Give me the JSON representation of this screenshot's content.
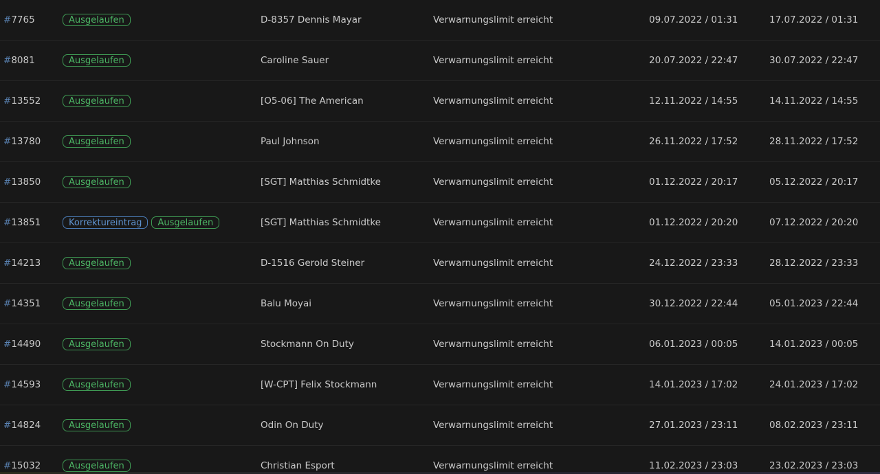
{
  "rows": [
    {
      "id": "7765",
      "badges": [
        {
          "label": "Ausgelaufen",
          "color": "green"
        }
      ],
      "name": "D-8357 Dennis Mayar",
      "reason": "Verwarnungslimit erreicht",
      "start": "09.07.2022 / 01:31",
      "end": "17.07.2022 / 01:31"
    },
    {
      "id": "8081",
      "badges": [
        {
          "label": "Ausgelaufen",
          "color": "green"
        }
      ],
      "name": "Caroline Sauer",
      "reason": "Verwarnungslimit erreicht",
      "start": "20.07.2022 / 22:47",
      "end": "30.07.2022 / 22:47"
    },
    {
      "id": "13552",
      "badges": [
        {
          "label": "Ausgelaufen",
          "color": "green"
        }
      ],
      "name": "[O5-06] The American",
      "reason": "Verwarnungslimit erreicht",
      "start": "12.11.2022 / 14:55",
      "end": "14.11.2022 / 14:55"
    },
    {
      "id": "13780",
      "badges": [
        {
          "label": "Ausgelaufen",
          "color": "green"
        }
      ],
      "name": "Paul Johnson",
      "reason": "Verwarnungslimit erreicht",
      "start": "26.11.2022 / 17:52",
      "end": "28.11.2022 / 17:52"
    },
    {
      "id": "13850",
      "badges": [
        {
          "label": "Ausgelaufen",
          "color": "green"
        }
      ],
      "name": "[SGT] Matthias Schmidtke",
      "reason": "Verwarnungslimit erreicht",
      "start": "01.12.2022 / 20:17",
      "end": "05.12.2022 / 20:17"
    },
    {
      "id": "13851",
      "badges": [
        {
          "label": "Korrektureintrag",
          "color": "blue"
        },
        {
          "label": "Ausgelaufen",
          "color": "green"
        }
      ],
      "name": "[SGT] Matthias Schmidtke",
      "reason": "Verwarnungslimit erreicht",
      "start": "01.12.2022 / 20:20",
      "end": "07.12.2022 / 20:20"
    },
    {
      "id": "14213",
      "badges": [
        {
          "label": "Ausgelaufen",
          "color": "green"
        }
      ],
      "name": "D-1516 Gerold Steiner",
      "reason": "Verwarnungslimit erreicht",
      "start": "24.12.2022 / 23:33",
      "end": "28.12.2022 / 23:33"
    },
    {
      "id": "14351",
      "badges": [
        {
          "label": "Ausgelaufen",
          "color": "green"
        }
      ],
      "name": "Balu Moyai",
      "reason": "Verwarnungslimit erreicht",
      "start": "30.12.2022 / 22:44",
      "end": "05.01.2023 / 22:44"
    },
    {
      "id": "14490",
      "badges": [
        {
          "label": "Ausgelaufen",
          "color": "green"
        }
      ],
      "name": "Stockmann On Duty",
      "reason": "Verwarnungslimit erreicht",
      "start": "06.01.2023 / 00:05",
      "end": "14.01.2023 / 00:05"
    },
    {
      "id": "14593",
      "badges": [
        {
          "label": "Ausgelaufen",
          "color": "green"
        }
      ],
      "name": "[W-CPT] Felix Stockmann",
      "reason": "Verwarnungslimit erreicht",
      "start": "14.01.2023 / 17:02",
      "end": "24.01.2023 / 17:02"
    },
    {
      "id": "14824",
      "badges": [
        {
          "label": "Ausgelaufen",
          "color": "green"
        }
      ],
      "name": "Odin On Duty",
      "reason": "Verwarnungslimit erreicht",
      "start": "27.01.2023 / 23:11",
      "end": "08.02.2023 / 23:11"
    },
    {
      "id": "15032",
      "badges": [
        {
          "label": "Ausgelaufen",
          "color": "green"
        }
      ],
      "name": "Christian Esport",
      "reason": "Verwarnungslimit erreicht",
      "start": "11.02.2023 / 23:03",
      "end": "23.02.2023 / 23:03"
    }
  ],
  "id_prefix": "#",
  "colors": {
    "background": "#181818",
    "row_divider": "#262626",
    "text": "#c9c9c9",
    "id_hash": "#5a83b4",
    "badge_green": "#4cb564",
    "badge_blue": "#5f93cf"
  }
}
